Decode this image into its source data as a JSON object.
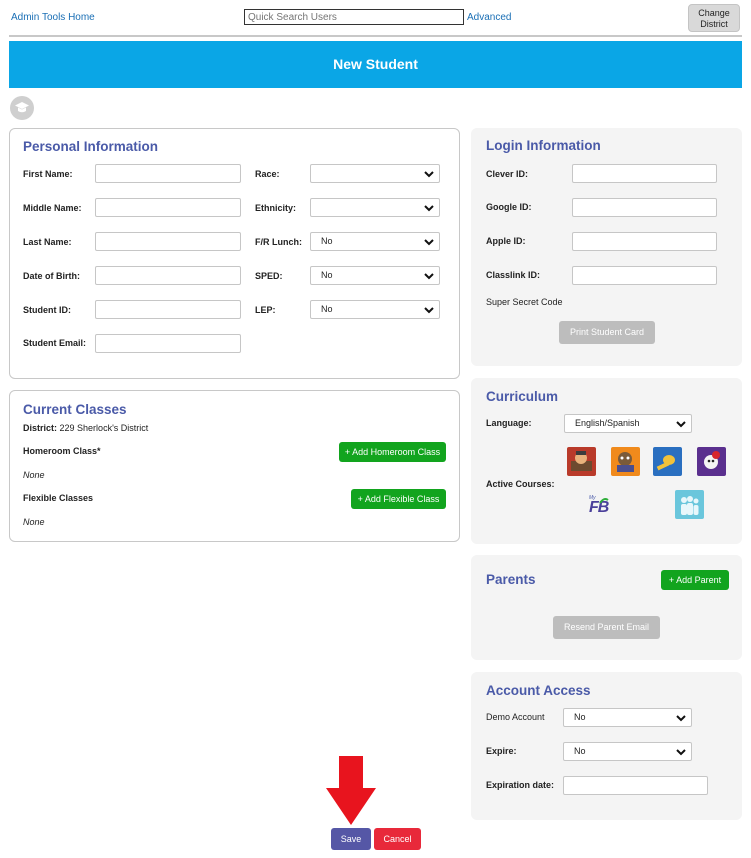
{
  "header": {
    "home_link": "Admin Tools Home",
    "search_placeholder": "Quick Search Users",
    "advanced_link": "Advanced",
    "change_district_line1": "Change",
    "change_district_line2": "District"
  },
  "banner": {
    "title": "New Student"
  },
  "personal": {
    "title": "Personal Information",
    "first_name": "First Name:",
    "middle_name": "Middle Name:",
    "last_name": "Last Name:",
    "dob": "Date of Birth:",
    "student_id": "Student ID:",
    "email": "Student Email:",
    "race": "Race:",
    "ethnicity": "Ethnicity:",
    "fr_lunch": "F/R Lunch:",
    "sped": "SPED:",
    "lep": "LEP:",
    "race_value": "",
    "ethnicity_value": "",
    "fr_lunch_value": "No",
    "sped_value": "No",
    "lep_value": "No"
  },
  "classes": {
    "title": "Current Classes",
    "district_label": "District:",
    "district_value": "229 Sherlock's District",
    "homeroom_label": "Homeroom Class*",
    "homeroom_button": "+ Add Homeroom Class",
    "homeroom_value": "None",
    "flexible_label": "Flexible Classes",
    "flexible_button": "+ Add Flexible Class",
    "flexible_value": "None"
  },
  "login": {
    "title": "Login Information",
    "clever": "Clever ID:",
    "google": "Google ID:",
    "apple": "Apple ID:",
    "classlink": "Classlink ID:",
    "secret_code": "Super Secret Code",
    "print_button": "Print Student Card"
  },
  "curriculum": {
    "title": "Curriculum",
    "language_label": "Language:",
    "language_value": "English/Spanish",
    "active_courses_label": "Active Courses:",
    "courses": [
      "course-1",
      "course-2",
      "course-3",
      "course-4",
      "course-fb",
      "course-6"
    ],
    "course_logo_text": "FB",
    "course_logo_small": "My"
  },
  "parents": {
    "title": "Parents",
    "add_button": "+ Add Parent",
    "resend_button": "Resend Parent Email"
  },
  "account": {
    "title": "Account Access",
    "demo_label": "Demo Account",
    "demo_value": "No",
    "expire_label": "Expire:",
    "expire_value": "No",
    "expiration_date_label": "Expiration date:"
  },
  "actions": {
    "save": "Save",
    "cancel": "Cancel"
  },
  "colors": {
    "banner": "#0aa6e6",
    "title": "#4a5aa8",
    "green": "#12a41e",
    "save": "#5557a6",
    "cancel": "#e8293a",
    "arrow": "#e8141e"
  }
}
